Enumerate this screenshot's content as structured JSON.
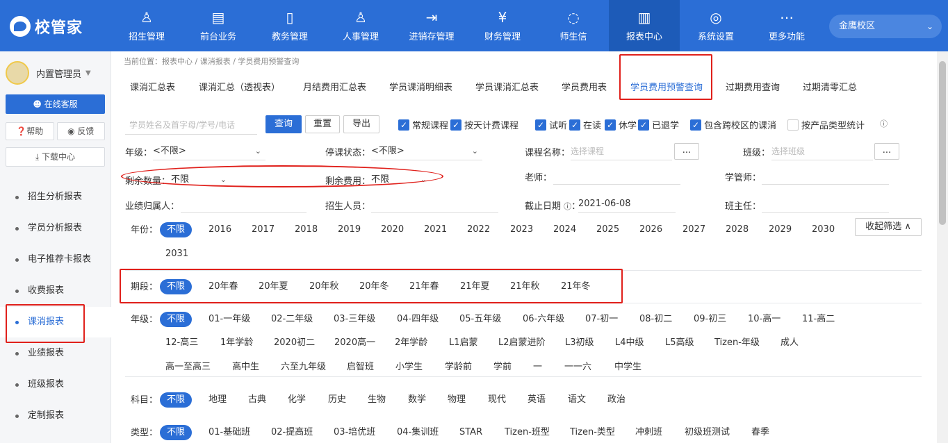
{
  "app": {
    "logo": "校管家",
    "campus": "金鹰校区"
  },
  "nav": [
    {
      "label": "招生管理",
      "icon": "user-plus-icon",
      "glyph": "♙"
    },
    {
      "label": "前台业务",
      "icon": "desk-icon",
      "glyph": "▤"
    },
    {
      "label": "教务管理",
      "icon": "book-icon",
      "glyph": "▯"
    },
    {
      "label": "人事管理",
      "icon": "person-icon",
      "glyph": "♙"
    },
    {
      "label": "进销存管理",
      "icon": "inventory-icon",
      "glyph": "⇥"
    },
    {
      "label": "财务管理",
      "icon": "yen-icon",
      "glyph": "¥"
    },
    {
      "label": "师生信",
      "icon": "chat-icon",
      "glyph": "◌"
    },
    {
      "label": "报表中心",
      "icon": "chart-icon",
      "glyph": "▥"
    },
    {
      "label": "系统设置",
      "icon": "gear-icon",
      "glyph": "◎"
    },
    {
      "label": "更多功能",
      "icon": "more-icon",
      "glyph": "⋯"
    }
  ],
  "sidebar": {
    "user": "内置管理员",
    "online_service": "在线客服",
    "help": "帮助",
    "feedback": "反馈",
    "download": "下载中心",
    "items": [
      "招生分析报表",
      "学员分析报表",
      "电子推荐卡报表",
      "收费报表",
      "课消报表",
      "业绩报表",
      "班级报表",
      "定制报表"
    ]
  },
  "breadcrumb": "当前位置：报表中心 / 课消报表 / 学员费用预警查询",
  "tabs": [
    "课消汇总表",
    "课消汇总（透视表）",
    "月结费用汇总表",
    "学员课消明细表",
    "学员课消汇总表",
    "学员费用表",
    "学员费用预警查询",
    "过期费用查询",
    "过期清零汇总"
  ],
  "search": {
    "placeholder": "学员姓名及首字母/学号/电话",
    "query": "查询",
    "reset": "重置",
    "export": "导出"
  },
  "checks": [
    {
      "label": "常规课程",
      "checked": true
    },
    {
      "label": "按天计费课程",
      "checked": true
    },
    {
      "label": "试听",
      "checked": true
    },
    {
      "label": "在读",
      "checked": true
    },
    {
      "label": "休学",
      "checked": true
    },
    {
      "label": "已退学",
      "checked": true
    },
    {
      "label": "包含跨校区的课消",
      "checked": true
    },
    {
      "label": "按产品类型统计",
      "checked": false
    }
  ],
  "filters": {
    "grade_label": "年级：",
    "grade_value": "<不限>",
    "stop_label": "停课状态：",
    "stop_value": "<不限>",
    "course_label": "课程名称：",
    "course_ph": "选择课程",
    "class_label": "班级：",
    "class_ph": "选择班级",
    "remain_qty_label": "剩余数量：",
    "remain_qty_value": "不限",
    "remain_fee_label": "剩余费用：",
    "remain_fee_value": "不限",
    "teacher_label": "老师：",
    "manager_label": "学管师：",
    "perf_label": "业绩归属人：",
    "recruiter_label": "招生人员：",
    "deadline_label": "截止日期",
    "deadline_value": "2021-06-08",
    "head_teacher_label": "班主任：",
    "more": "..."
  },
  "year": {
    "label": "年份：",
    "options": [
      "不限",
      "2016",
      "2017",
      "2018",
      "2019",
      "2020",
      "2021",
      "2022",
      "2023",
      "2024",
      "2025",
      "2026",
      "2027",
      "2028",
      "2029",
      "2030",
      "2031"
    ]
  },
  "collapse": "收起筛选",
  "term": {
    "label": "期段：",
    "options": [
      "不限",
      "20年春",
      "20年夏",
      "20年秋",
      "20年冬",
      "21年春",
      "21年夏",
      "21年秋",
      "21年冬"
    ]
  },
  "grade": {
    "label": "年级：",
    "options": [
      "不限",
      "01-一年级",
      "02-二年级",
      "03-三年级",
      "04-四年级",
      "05-五年级",
      "06-六年级",
      "07-初一",
      "08-初二",
      "09-初三",
      "10-高一",
      "11-高二",
      "12-高三",
      "1年学龄",
      "2020初二",
      "2020高一",
      "2年学龄",
      "L1启蒙",
      "L2启蒙进阶",
      "L3初级",
      "L4中级",
      "L5高级",
      "Tizen-年级",
      "成人",
      "高一至高三",
      "高中生",
      "六至九年级",
      "启智班",
      "小学生",
      "学龄前",
      "学前",
      "一",
      "一一六",
      "中学生"
    ]
  },
  "subject": {
    "label": "科目：",
    "options": [
      "不限",
      "地理",
      "古典",
      "化学",
      "历史",
      "生物",
      "数学",
      "物理",
      "现代",
      "英语",
      "语文",
      "政治"
    ]
  },
  "type": {
    "label": "类型：",
    "options": [
      "不限",
      "01-基础班",
      "02-提高班",
      "03-培优班",
      "04-集训班",
      "STAR",
      "Tizen-班型",
      "Tizen-类型",
      "冲刺班",
      "初级班测试",
      "春季"
    ]
  }
}
